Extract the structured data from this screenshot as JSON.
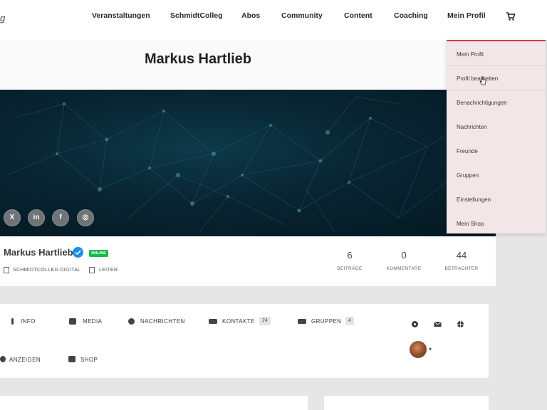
{
  "header": {
    "logo_fragment": "g",
    "nav": [
      "Veranstaltungen",
      "SchmidtColleg",
      "Abos",
      "Community",
      "Content",
      "Coaching",
      "Mein Profil"
    ]
  },
  "profile_menu": {
    "items": [
      "Mein Profil",
      "Profil bearbeiten",
      "Benachrichtigungen",
      "Nachrichten",
      "Freunde",
      "Gruppen",
      "Einstellungen",
      "Mein Shop"
    ]
  },
  "page": {
    "title": "Markus Hartlieb"
  },
  "cover": {
    "social_icons": [
      "x-icon",
      "linkedin-icon",
      "facebook-icon",
      "instagram-icon"
    ],
    "social_labels": [
      "X",
      "in",
      "f",
      "◎"
    ]
  },
  "profile": {
    "name": "Markus Hartlieb",
    "status": "ONLINE",
    "company": "SCHMIDTCOLLEG DIGITAL",
    "role": "LEITER",
    "stats": [
      {
        "value": "6",
        "label": "BEITRÄGE"
      },
      {
        "value": "0",
        "label": "KOMMENTARE"
      },
      {
        "value": "44",
        "label": "BETRACHTER"
      }
    ]
  },
  "tabs": {
    "info": "INFO",
    "media": "MEDIA",
    "messages": "NACHRICHTEN",
    "contacts": "KONTAKTE",
    "contacts_count": "24",
    "groups": "GRUPPEN",
    "groups_count": "4",
    "ads": "ANZEIGEN",
    "shop": "SHOP"
  },
  "colors": {
    "accent": "#d43a4a",
    "online": "#19b84a",
    "verified": "#1d8fe8",
    "dropdown_bg": "#f3e6e8"
  }
}
